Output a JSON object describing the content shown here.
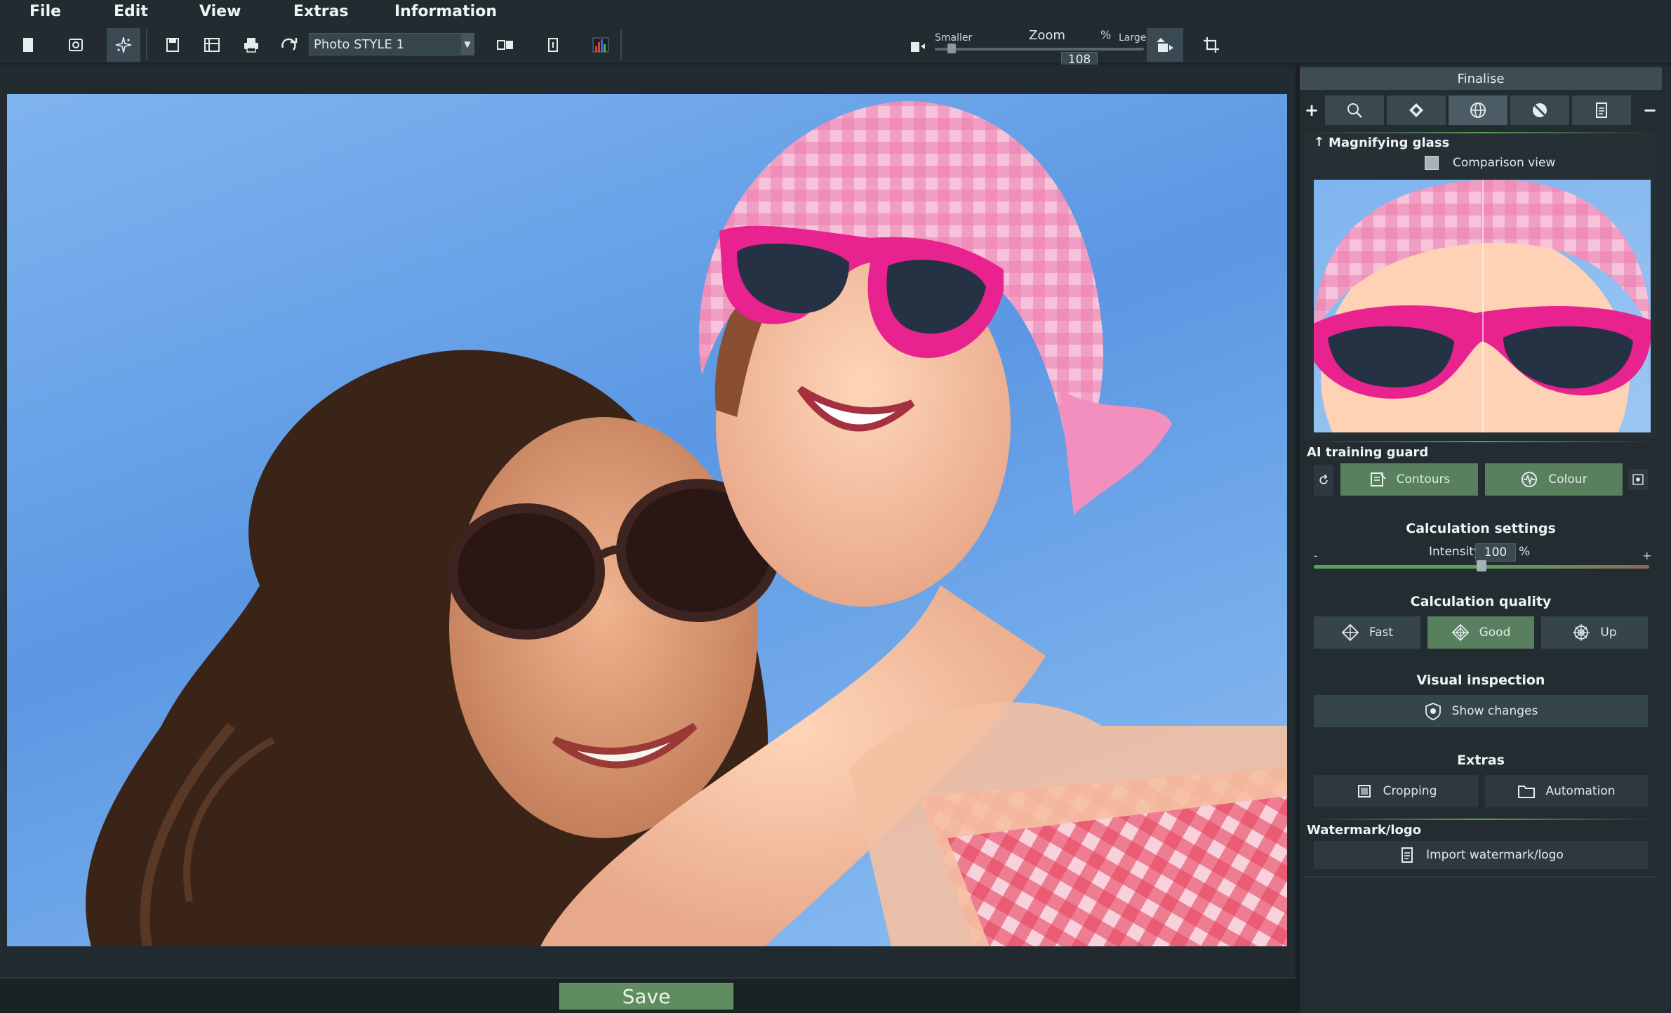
{
  "menu": {
    "file": "File",
    "edit": "Edit",
    "view": "View",
    "extras": "Extras",
    "information": "Information"
  },
  "toolbar": {
    "preset_value": "Photo STYLE 1",
    "zoom_smaller": "Smaller",
    "zoom_label": "Zoom",
    "zoom_value": "108",
    "zoom_unit": "%",
    "zoom_larger": "Larger"
  },
  "canvas": {
    "save_label": "Save"
  },
  "panel": {
    "header": "Finalise",
    "tab_plus": "+",
    "tab_minus": "−",
    "magnifier": {
      "title": "Magnifying glass",
      "comparison_label": "Comparison view"
    },
    "ai_guard": {
      "title": "AI training guard",
      "contours": "Contours",
      "colour": "Colour"
    },
    "calc_settings": {
      "title": "Calculation settings",
      "intensity_label": "Intensity",
      "intensity_value": "100",
      "intensity_unit": "%",
      "min_sign": "-",
      "max_sign": "+",
      "intensity_fraction": 0.5
    },
    "calc_quality": {
      "title": "Calculation quality",
      "fast": "Fast",
      "good": "Good",
      "up": "Up",
      "selected": "Good"
    },
    "visual_inspection": {
      "title": "Visual inspection",
      "show_changes": "Show changes"
    },
    "extras": {
      "title": "Extras",
      "cropping": "Cropping",
      "automation": "Automation"
    },
    "watermark": {
      "title": "Watermark/logo",
      "import": "Import watermark/logo"
    }
  },
  "colors": {
    "background": "#212a2f",
    "panel": "#232c31",
    "accent_green": "#5f8d5f",
    "button": "#36444b"
  }
}
